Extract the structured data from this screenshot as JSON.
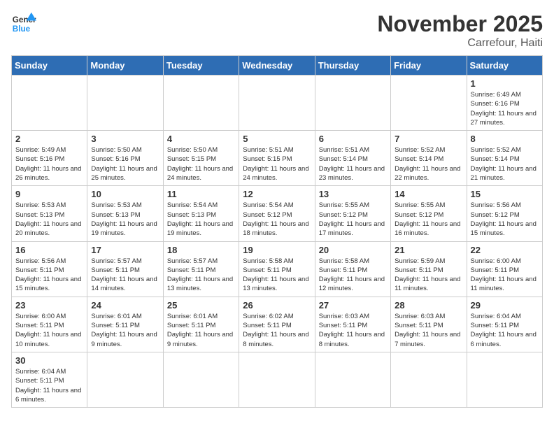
{
  "header": {
    "logo_general": "General",
    "logo_blue": "Blue",
    "month_year": "November 2025",
    "location": "Carrefour, Haiti"
  },
  "days_of_week": [
    "Sunday",
    "Monday",
    "Tuesday",
    "Wednesday",
    "Thursday",
    "Friday",
    "Saturday"
  ],
  "weeks": [
    [
      {
        "day": "",
        "info": ""
      },
      {
        "day": "",
        "info": ""
      },
      {
        "day": "",
        "info": ""
      },
      {
        "day": "",
        "info": ""
      },
      {
        "day": "",
        "info": ""
      },
      {
        "day": "",
        "info": ""
      },
      {
        "day": "1",
        "info": "Sunrise: 6:49 AM\nSunset: 6:16 PM\nDaylight: 11 hours and 27 minutes."
      }
    ],
    [
      {
        "day": "2",
        "info": "Sunrise: 5:49 AM\nSunset: 5:16 PM\nDaylight: 11 hours and 26 minutes."
      },
      {
        "day": "3",
        "info": "Sunrise: 5:50 AM\nSunset: 5:16 PM\nDaylight: 11 hours and 25 minutes."
      },
      {
        "day": "4",
        "info": "Sunrise: 5:50 AM\nSunset: 5:15 PM\nDaylight: 11 hours and 24 minutes."
      },
      {
        "day": "5",
        "info": "Sunrise: 5:51 AM\nSunset: 5:15 PM\nDaylight: 11 hours and 24 minutes."
      },
      {
        "day": "6",
        "info": "Sunrise: 5:51 AM\nSunset: 5:14 PM\nDaylight: 11 hours and 23 minutes."
      },
      {
        "day": "7",
        "info": "Sunrise: 5:52 AM\nSunset: 5:14 PM\nDaylight: 11 hours and 22 minutes."
      },
      {
        "day": "8",
        "info": "Sunrise: 5:52 AM\nSunset: 5:14 PM\nDaylight: 11 hours and 21 minutes."
      }
    ],
    [
      {
        "day": "9",
        "info": "Sunrise: 5:53 AM\nSunset: 5:13 PM\nDaylight: 11 hours and 20 minutes."
      },
      {
        "day": "10",
        "info": "Sunrise: 5:53 AM\nSunset: 5:13 PM\nDaylight: 11 hours and 19 minutes."
      },
      {
        "day": "11",
        "info": "Sunrise: 5:54 AM\nSunset: 5:13 PM\nDaylight: 11 hours and 19 minutes."
      },
      {
        "day": "12",
        "info": "Sunrise: 5:54 AM\nSunset: 5:12 PM\nDaylight: 11 hours and 18 minutes."
      },
      {
        "day": "13",
        "info": "Sunrise: 5:55 AM\nSunset: 5:12 PM\nDaylight: 11 hours and 17 minutes."
      },
      {
        "day": "14",
        "info": "Sunrise: 5:55 AM\nSunset: 5:12 PM\nDaylight: 11 hours and 16 minutes."
      },
      {
        "day": "15",
        "info": "Sunrise: 5:56 AM\nSunset: 5:12 PM\nDaylight: 11 hours and 15 minutes."
      }
    ],
    [
      {
        "day": "16",
        "info": "Sunrise: 5:56 AM\nSunset: 5:11 PM\nDaylight: 11 hours and 15 minutes."
      },
      {
        "day": "17",
        "info": "Sunrise: 5:57 AM\nSunset: 5:11 PM\nDaylight: 11 hours and 14 minutes."
      },
      {
        "day": "18",
        "info": "Sunrise: 5:57 AM\nSunset: 5:11 PM\nDaylight: 11 hours and 13 minutes."
      },
      {
        "day": "19",
        "info": "Sunrise: 5:58 AM\nSunset: 5:11 PM\nDaylight: 11 hours and 13 minutes."
      },
      {
        "day": "20",
        "info": "Sunrise: 5:58 AM\nSunset: 5:11 PM\nDaylight: 11 hours and 12 minutes."
      },
      {
        "day": "21",
        "info": "Sunrise: 5:59 AM\nSunset: 5:11 PM\nDaylight: 11 hours and 11 minutes."
      },
      {
        "day": "22",
        "info": "Sunrise: 6:00 AM\nSunset: 5:11 PM\nDaylight: 11 hours and 11 minutes."
      }
    ],
    [
      {
        "day": "23",
        "info": "Sunrise: 6:00 AM\nSunset: 5:11 PM\nDaylight: 11 hours and 10 minutes."
      },
      {
        "day": "24",
        "info": "Sunrise: 6:01 AM\nSunset: 5:11 PM\nDaylight: 11 hours and 9 minutes."
      },
      {
        "day": "25",
        "info": "Sunrise: 6:01 AM\nSunset: 5:11 PM\nDaylight: 11 hours and 9 minutes."
      },
      {
        "day": "26",
        "info": "Sunrise: 6:02 AM\nSunset: 5:11 PM\nDaylight: 11 hours and 8 minutes."
      },
      {
        "day": "27",
        "info": "Sunrise: 6:03 AM\nSunset: 5:11 PM\nDaylight: 11 hours and 8 minutes."
      },
      {
        "day": "28",
        "info": "Sunrise: 6:03 AM\nSunset: 5:11 PM\nDaylight: 11 hours and 7 minutes."
      },
      {
        "day": "29",
        "info": "Sunrise: 6:04 AM\nSunset: 5:11 PM\nDaylight: 11 hours and 6 minutes."
      }
    ],
    [
      {
        "day": "30",
        "info": "Sunrise: 6:04 AM\nSunset: 5:11 PM\nDaylight: 11 hours and 6 minutes."
      },
      {
        "day": "",
        "info": ""
      },
      {
        "day": "",
        "info": ""
      },
      {
        "day": "",
        "info": ""
      },
      {
        "day": "",
        "info": ""
      },
      {
        "day": "",
        "info": ""
      },
      {
        "day": "",
        "info": ""
      }
    ]
  ]
}
